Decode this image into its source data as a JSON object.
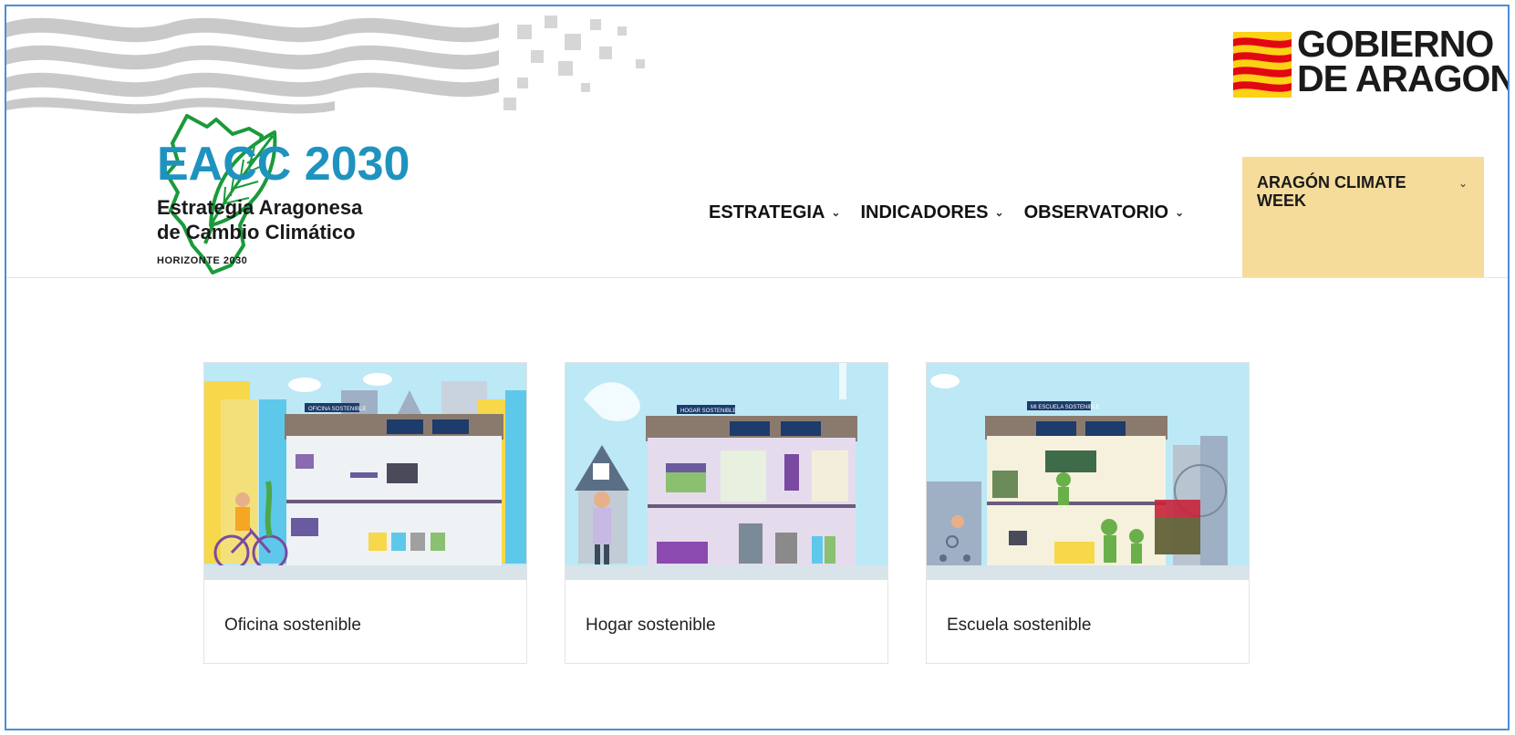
{
  "header": {
    "gov_logo": {
      "line1": "GOBIERNO",
      "line2": "DE ARAGON"
    },
    "brand": {
      "title": "EACC 2030",
      "subtitle_line1": "Estrategia Aragonesa",
      "subtitle_line2": "de Cambio Climático",
      "horizon": "HORIZONTE 2030"
    },
    "nav": [
      {
        "label": "ESTRATEGIA",
        "icon": "chevron-down-icon"
      },
      {
        "label": "INDICADORES",
        "icon": "chevron-down-icon"
      },
      {
        "label": "OBSERVATORIO",
        "icon": "chevron-down-icon"
      }
    ],
    "climate_week": {
      "label": "ARAGÓN CLIMATE WEEK",
      "icon": "chevron-down-icon"
    }
  },
  "cards": [
    {
      "title": "Oficina sostenible",
      "sign": "OFICINA SOSTENIBLE"
    },
    {
      "title": "Hogar sostenible",
      "sign": "HOGAR SOSTENIBLE"
    },
    {
      "title": "Escuela sostenible",
      "sign": "MI ESCUELA SOSTENIBLE"
    }
  ],
  "colors": {
    "brand_blue": "#1f93bf",
    "brand_green": "#1a9a3a",
    "climate_bg": "#f5dc9b",
    "flag_yellow": "#fcd116",
    "flag_red": "#e30613",
    "sky": "#bde8f5"
  }
}
